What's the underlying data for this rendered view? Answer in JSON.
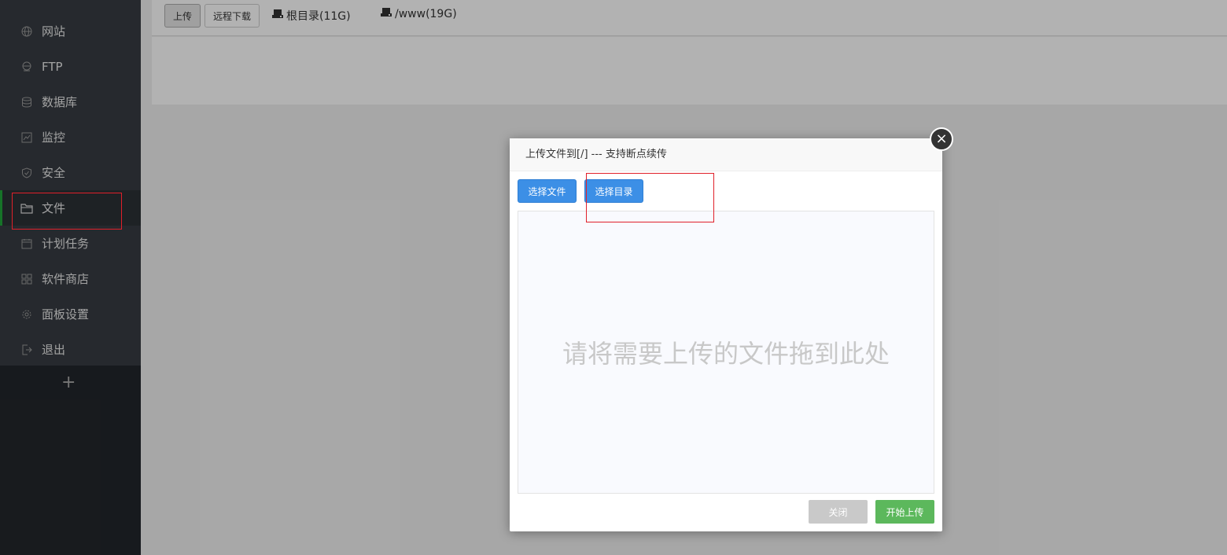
{
  "sidebar": {
    "items": [
      {
        "label": "网站",
        "icon": "globe-icon"
      },
      {
        "label": "FTP",
        "icon": "ftp-icon"
      },
      {
        "label": "数据库",
        "icon": "database-icon"
      },
      {
        "label": "监控",
        "icon": "monitor-icon"
      },
      {
        "label": "安全",
        "icon": "shield-icon"
      },
      {
        "label": "文件",
        "icon": "folder-icon",
        "active": true
      },
      {
        "label": "计划任务",
        "icon": "calendar-icon"
      },
      {
        "label": "软件商店",
        "icon": "grid-icon"
      },
      {
        "label": "面板设置",
        "icon": "gear-icon"
      },
      {
        "label": "退出",
        "icon": "logout-icon"
      }
    ],
    "add_label": "+"
  },
  "toolbar": {
    "upload_label": "上传",
    "remote_download_label": "远程下载",
    "disks": [
      {
        "label": "根目录(11G)",
        "icon": "disk-icon"
      },
      {
        "label": "/www(19G)",
        "icon": "disk-icon"
      }
    ]
  },
  "dialog": {
    "title": "上传文件到[/] --- 支持断点续传",
    "close_symbol": "×",
    "select_file_label": "选择文件",
    "select_dir_label": "选择目录",
    "drop_hint": "请将需要上传的文件拖到此处",
    "close_label": "关闭",
    "start_label": "开始上传"
  },
  "colors": {
    "sidebar_bg": "#373c42",
    "active_accent": "#20a53a",
    "primary_blue": "#3c8fe6",
    "success_green": "#5cb85c",
    "highlight_red": "#e0202a"
  }
}
